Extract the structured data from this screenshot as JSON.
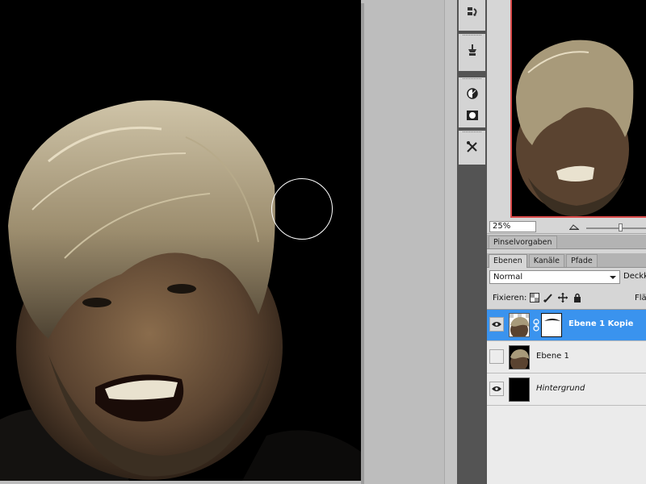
{
  "navigator": {
    "zoom_value": "25%"
  },
  "panels": {
    "brush_presets_tab": "Pinselvorgaben",
    "layers_tabs": [
      "Ebenen",
      "Kanäle",
      "Pfade"
    ]
  },
  "layers_panel": {
    "blend_mode": "Normal",
    "opacity_label": "Deckk",
    "lock_label": "Fixieren:",
    "fill_label": "Fläc",
    "layers": [
      {
        "name": "Ebene 1 Kopie",
        "visible": true,
        "selected": true,
        "has_mask": true
      },
      {
        "name": "Ebene 1",
        "visible": false,
        "selected": false,
        "has_mask": false
      },
      {
        "name": "Hintergrund",
        "visible": true,
        "selected": false,
        "has_mask": false,
        "italic": true
      }
    ]
  },
  "dock_tools": [
    "history-icon",
    "clone-source-icon",
    "color-adjust-icon",
    "mask-icon",
    "brush-tool-presets-icon"
  ],
  "colors": {
    "selection_blue": "#3a93ee",
    "navigator_frame": "#d94a4a",
    "canvas_background": "#000000"
  }
}
